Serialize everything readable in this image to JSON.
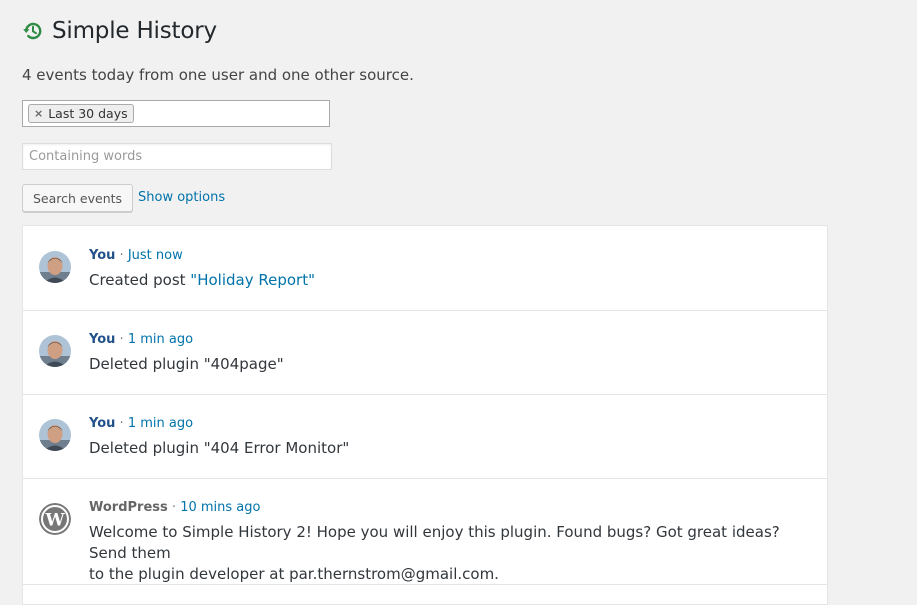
{
  "page": {
    "title": "Simple History",
    "summary": "4 events today from one user and one other source."
  },
  "filters": {
    "date_chip": "Last 30 days",
    "words_placeholder": "Containing words",
    "search_button": "Search events",
    "show_options": "Show options"
  },
  "events": [
    {
      "who": "You",
      "when": "Just now",
      "text_before": "Created post ",
      "link": "\"Holiday Report\"",
      "text_after": ""
    },
    {
      "who": "You",
      "when": "1 min ago",
      "text": "Deleted plugin \"404page\""
    },
    {
      "who": "You",
      "when": "1 min ago",
      "text": "Deleted plugin \"404 Error Monitor\""
    },
    {
      "who": "WordPress",
      "when": "10 mins ago",
      "text_line1": "Welcome to Simple History 2! Hope you will enjoy this plugin. Found bugs? Got great ideas? Send them",
      "text_line2": "to the plugin developer at par.thernstrom@gmail.com."
    }
  ],
  "icons": {
    "title_icon": "history-icon",
    "avatar": "user-avatar",
    "wordpress": "wordpress-logo-icon"
  },
  "colors": {
    "accent": "#0073aa",
    "user_name": "#23528a",
    "history_icon": "#2e8b45"
  },
  "separator": "·"
}
